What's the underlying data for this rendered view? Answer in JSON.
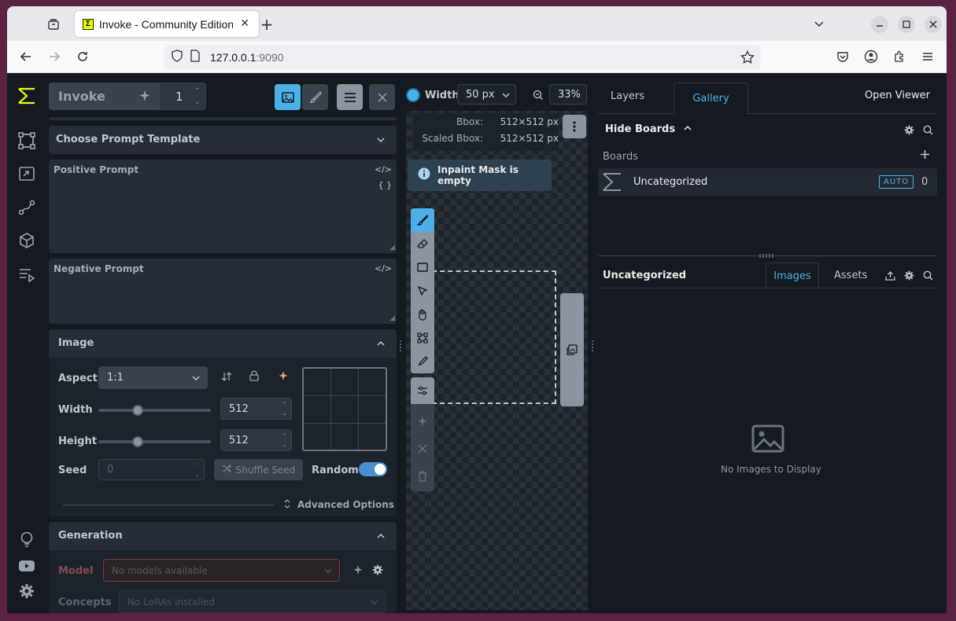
{
  "browser": {
    "tab_title": "Invoke - Community Edition",
    "favicon_letter": "Σ",
    "url_host": "127.0.0.1",
    "url_port": ":9090",
    "new_tab_symbol": "+"
  },
  "toolbar": {
    "invoke_label": "Invoke",
    "iterations": "1"
  },
  "prompts": {
    "template_label": "Choose Prompt Template",
    "positive_label": "Positive Prompt",
    "negative_label": "Negative Prompt",
    "code_symbol": "</>",
    "braces_symbol": "{ }"
  },
  "image": {
    "section_title": "Image",
    "aspect_label": "Aspect",
    "aspect_value": "1:1",
    "width_label": "Width",
    "width_value": "512",
    "width_fraction": 0.35,
    "height_label": "Height",
    "height_value": "512",
    "height_fraction": 0.35,
    "seed_label": "Seed",
    "seed_value": "0",
    "shuffle_label": "Shuffle Seed",
    "random_label": "Random",
    "random_on": true,
    "advanced_label": "Advanced Options"
  },
  "generation": {
    "section_title": "Generation",
    "model_label": "Model",
    "model_placeholder": "No models available",
    "concepts_label": "Concepts",
    "concepts_placeholder": "No LoRAs installed"
  },
  "canvas": {
    "width_label": "Width",
    "brush_width": "50 px",
    "zoom": "33%",
    "bbox_label": "Bbox:",
    "bbox_value": "512×512 px",
    "scaled_bbox_label": "Scaled Bbox:",
    "scaled_bbox_value": "512×512 px",
    "notice": "Inpaint Mask is empty",
    "accent_color": "#4cb0e8"
  },
  "gallery": {
    "tab_layers": "Layers",
    "tab_gallery": "Gallery",
    "open_viewer": "Open Viewer",
    "hide_boards": "Hide Boards",
    "boards_label": "Boards",
    "board_name": "Uncategorized",
    "board_badge": "AUTO",
    "board_count": "0",
    "current_board": "Uncategorized",
    "tab_images": "Images",
    "tab_assets": "Assets",
    "empty_text": "No Images to Display"
  }
}
